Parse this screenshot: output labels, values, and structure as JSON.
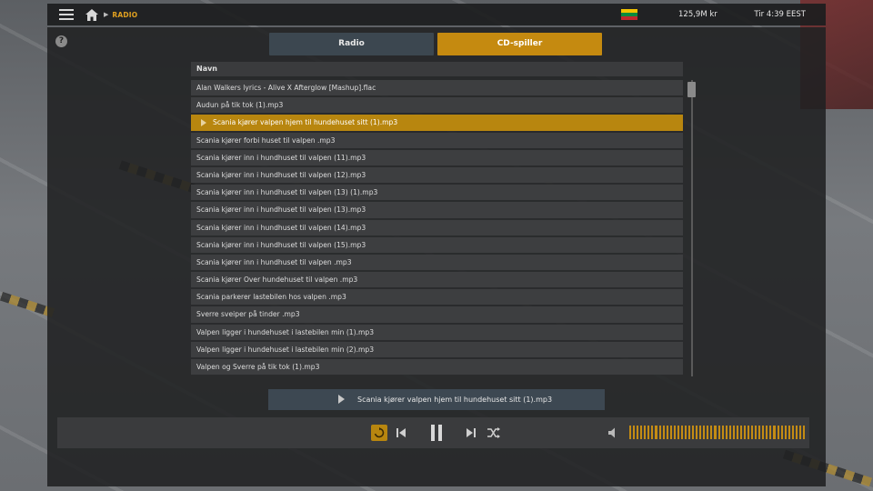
{
  "topbar": {
    "breadcrumb": "RADIO",
    "money": "125,9M kr",
    "clock": "Tir 4:39 EEST",
    "flag_colors": [
      "#f3c300",
      "#0b8a3e",
      "#c1272d"
    ]
  },
  "tabs": {
    "radio": "Radio",
    "cd": "CD-spiller",
    "active": "cd"
  },
  "list": {
    "header": "Navn",
    "tracks": [
      "Alan Walkers lyrics - Alive X Afterglow [Mashup].flac",
      "Audun på tik tok  (1).mp3",
      "Scania  kjører valpen hjem til hundehuset sitt  (1).mp3",
      "Scania kjører forbi huset til valpen .mp3",
      "Scania kjører inn i hundhuset til valpen  (11).mp3",
      "Scania kjører inn i hundhuset til valpen  (12).mp3",
      "Scania kjører inn i hundhuset til valpen  (13) (1).mp3",
      "Scania kjører inn i hundhuset til valpen  (13).mp3",
      "Scania kjører inn i hundhuset til valpen  (14).mp3",
      "Scania kjører inn i hundhuset til valpen  (15).mp3",
      "Scania kjører inn i hundhuset til valpen .mp3",
      "Scania kjører Over hundehuset til valpen .mp3",
      "Scania parkerer lastebilen hos valpen .mp3",
      "Sverre sveiper på tinder .mp3",
      "Valpen  ligger i hundehuset i lastebilen min (1).mp3",
      "Valpen  ligger i hundehuset i lastebilen min (2).mp3",
      "Valpen og Sverre på tik tok  (1).mp3"
    ],
    "active_index": 2
  },
  "now_playing": "Scania  kjører valpen hjem til hundehuset sitt  (1).mp3",
  "controls": {
    "repeat_active": true,
    "volume_level": 1.0,
    "accent": "#c58a10"
  },
  "icons": {
    "menu": "hamburger-icon",
    "home": "home-icon",
    "help": "?",
    "repeat": "repeat-icon",
    "prev": "skip-previous-icon",
    "pause": "pause-icon",
    "next": "skip-next-icon",
    "shuffle": "shuffle-icon",
    "speaker": "speaker-icon"
  }
}
